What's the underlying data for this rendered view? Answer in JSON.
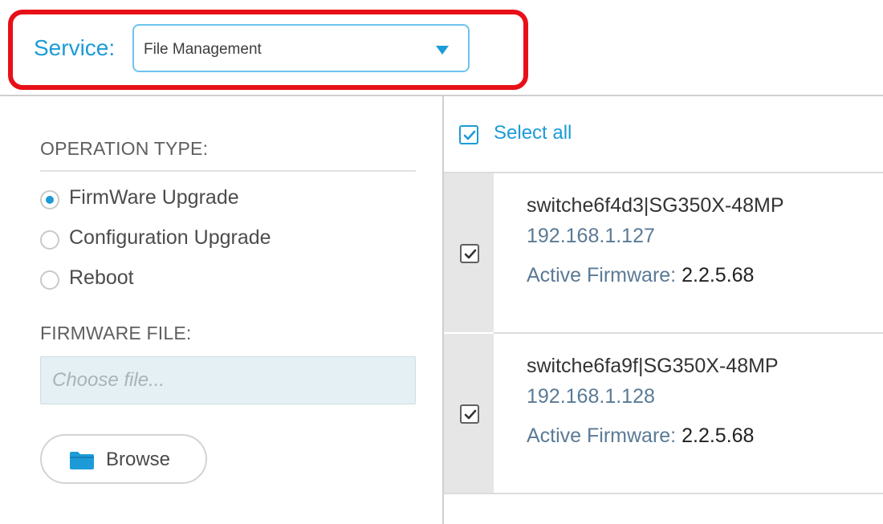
{
  "service": {
    "label": "Service:",
    "selected": "File Management"
  },
  "operation": {
    "heading": "OPERATION TYPE:",
    "options": [
      {
        "label": "FirmWare Upgrade",
        "checked": true
      },
      {
        "label": "Configuration Upgrade",
        "checked": false
      },
      {
        "label": "Reboot",
        "checked": false
      }
    ]
  },
  "firmware_file": {
    "heading": "FIRMWARE FILE:",
    "placeholder": "Choose file...",
    "value": ""
  },
  "browse": {
    "label": "Browse",
    "icon": "folder-icon"
  },
  "select_all": {
    "label": "Select all",
    "checked": true
  },
  "devices": [
    {
      "name": "switche6f4d3|SG350X-48MP",
      "ip": "192.168.1.127",
      "firmware_label": "Active Firmware:",
      "firmware_version": "2.2.5.68",
      "checked": true
    },
    {
      "name": "switche6fa9f|SG350X-48MP",
      "ip": "192.168.1.128",
      "firmware_label": "Active Firmware:",
      "firmware_version": "2.2.5.68",
      "checked": true
    }
  ],
  "colors": {
    "accent": "#1c9bd8",
    "highlight": "#e81018",
    "ip_text": "#5a7a96"
  }
}
